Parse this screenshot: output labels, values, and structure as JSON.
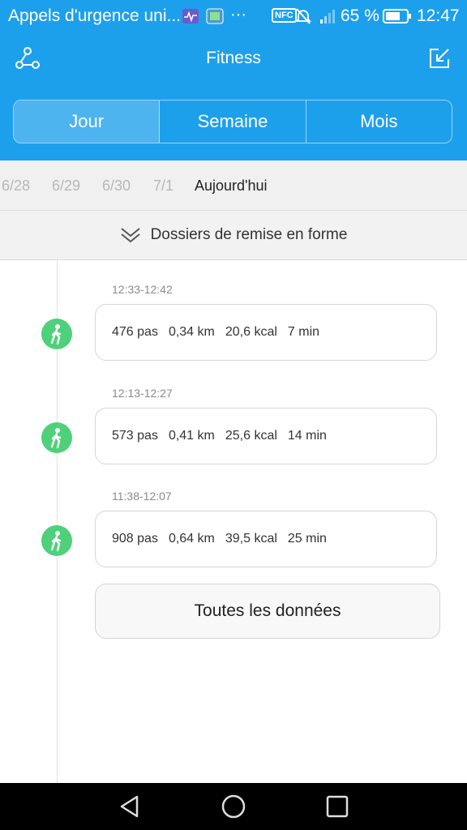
{
  "status_bar": {
    "notification_title": "Appels d'urgence uni...",
    "overflow": "···",
    "nfc": "NFC",
    "battery_percent": "65 %",
    "time": "12:47",
    "icons": [
      "heart-monitor-icon",
      "image-icon",
      "nfc-icon",
      "mute-icon",
      "signal-icon",
      "battery-icon"
    ]
  },
  "app_bar": {
    "title": "Fitness",
    "left_icon": "share-icon",
    "right_icon": "export-icon"
  },
  "tabs": [
    {
      "label": "Jour",
      "active": true
    },
    {
      "label": "Semaine",
      "active": false
    },
    {
      "label": "Mois",
      "active": false
    }
  ],
  "dates": [
    "6/28",
    "6/29",
    "6/30",
    "7/1",
    "Aujourd'hui"
  ],
  "records_header": {
    "label": "Dossiers de remise en forme",
    "icon": "double-chevron-down-icon"
  },
  "activities": [
    {
      "time": "12:33-12:42",
      "steps": "476 pas",
      "distance": "0,34 km",
      "calories": "20,6 kcal",
      "duration": "7 min"
    },
    {
      "time": "12:13-12:27",
      "steps": "573 pas",
      "distance": "0,41 km",
      "calories": "25,6 kcal",
      "duration": "14 min"
    },
    {
      "time": "11:38-12:07",
      "steps": "908 pas",
      "distance": "0,64 km",
      "calories": "39,5 kcal",
      "duration": "25 min"
    }
  ],
  "all_data_button": "Toutes les données",
  "colors": {
    "header_blue": "#1da0ec",
    "active_tab": "#4db4f0",
    "walk_green": "#4fd07a"
  }
}
